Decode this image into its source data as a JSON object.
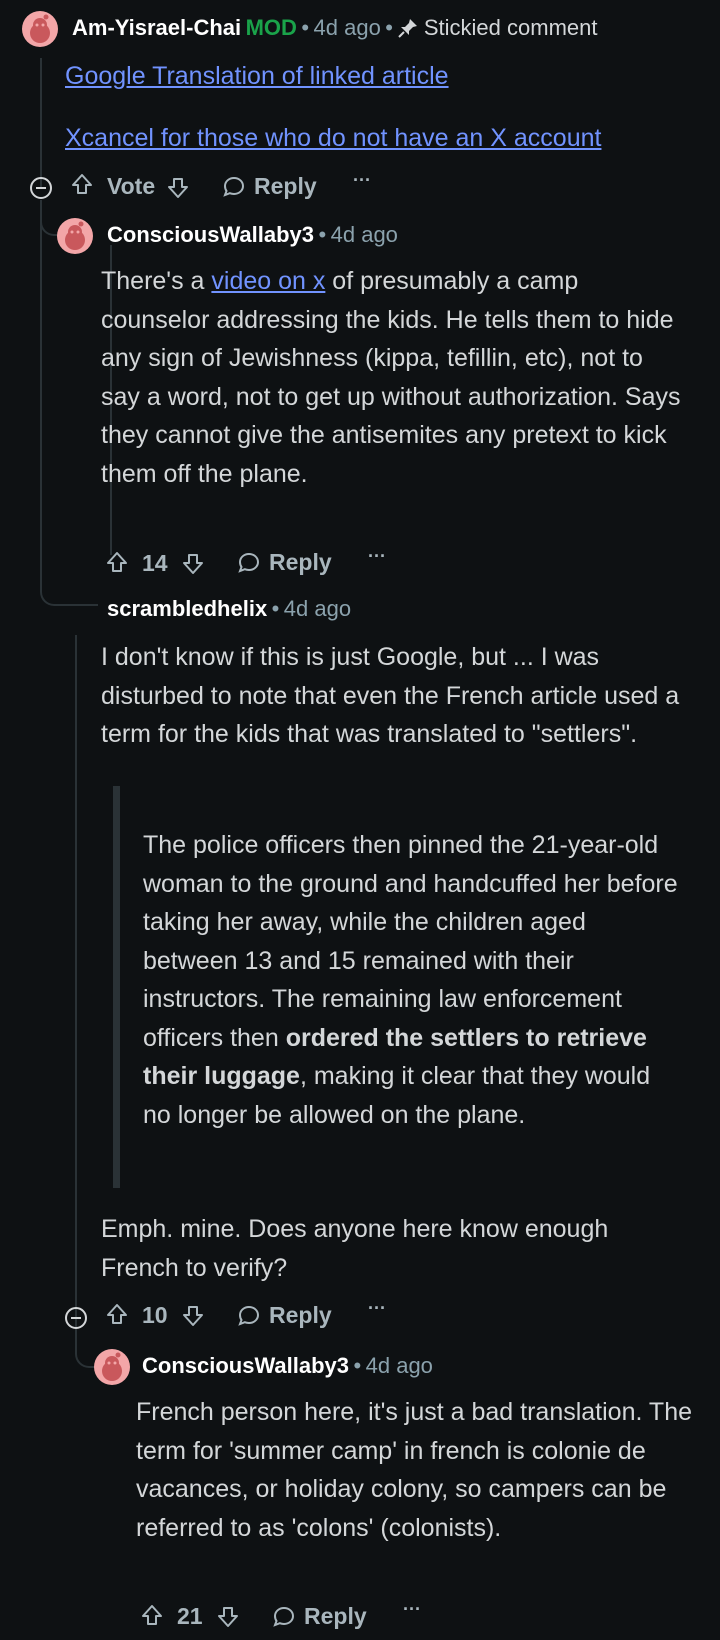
{
  "c1": {
    "author": "Am-Yisrael-Chai",
    "badge": "MOD",
    "sep1": "•",
    "time": "4d ago",
    "sep2": "•",
    "pinned": "Stickied comment",
    "link1": "Google Translation of linked article",
    "link2": "Xcancel for those who do not have an X account",
    "vote": "Vote",
    "reply": "Reply",
    "more": "···"
  },
  "c2": {
    "author": "ConsciousWallaby3",
    "sep": "•",
    "time": "4d ago",
    "text_before": "There's a ",
    "link": "video on x",
    "text_after": " of presumably a camp counselor addressing the kids. He tells them to hide any sign of Jewishness (kippa, tefillin, etc), not to say a word, not to get up without authorization. Says they cannot give the antisemites any pretext to kick them off the plane.",
    "score": "14",
    "reply": "Reply",
    "more": "···"
  },
  "c3": {
    "author": "scrambledhelix",
    "sep": "•",
    "time": "4d ago",
    "para1": "I don't know if this is just Google, but ... I was disturbed to note that even the French article used a term for the kids that was translated to \"settlers\".",
    "quote_before": "The police officers then pinned the 21-year-old woman to the ground and handcuffed her before taking her away, while the children aged between 13 and 15 remained with their instructors. The remaining law enforcement officers then ",
    "quote_bold": "ordered the settlers to retrieve their luggage",
    "quote_after": ", making it clear that they would no longer be allowed on the plane.",
    "para2": "Emph. mine. Does anyone here know enough French to verify?",
    "score": "10",
    "reply": "Reply",
    "more": "···"
  },
  "c4": {
    "author": "ConsciousWallaby3",
    "sep": "•",
    "time": "4d ago",
    "text": "French person here, it's just a bad translation. The term for 'summer camp' in french is colonie de vacances, or holiday colony, so campers can be referred to as 'colons' (colonists).",
    "score": "21",
    "reply": "Reply",
    "more": "···"
  },
  "icons": [
    "avatar-icon",
    "pin-icon",
    "upvote-icon",
    "downvote-icon",
    "reply-icon",
    "collapse-icon",
    "more-icon"
  ],
  "colors": {
    "background": "#0e1113",
    "link": "#7193ff",
    "mod": "#1aa34a",
    "avatar": "#f3a6a8"
  }
}
